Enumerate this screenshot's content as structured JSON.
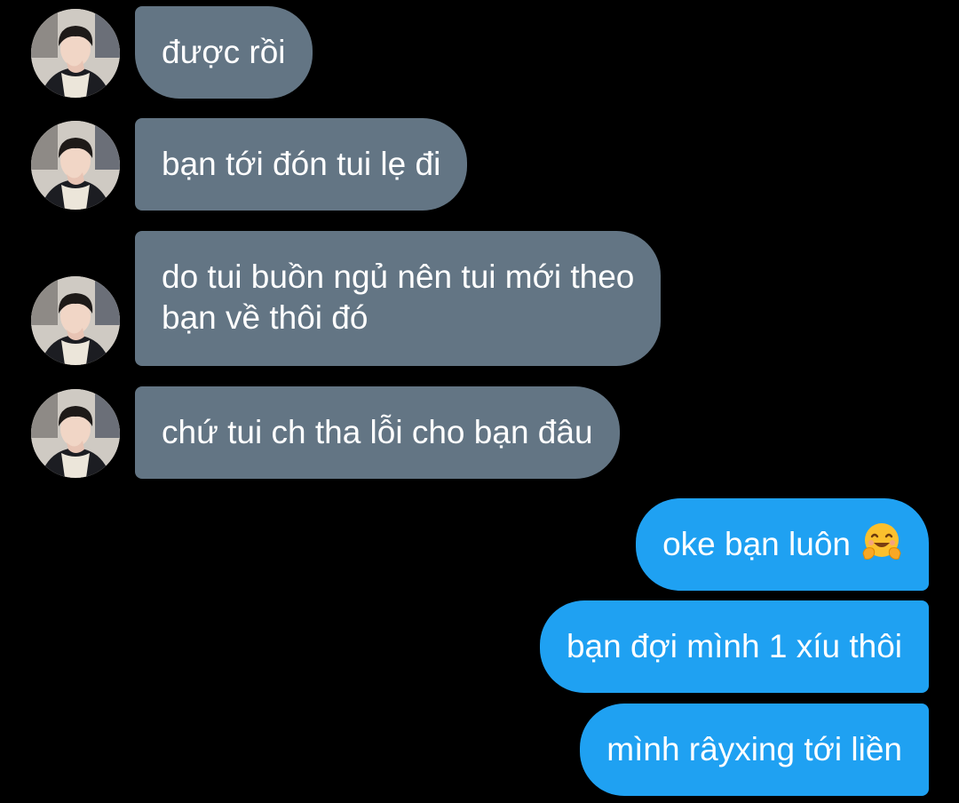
{
  "conversation": {
    "incoming": [
      {
        "text": "được rồi"
      },
      {
        "text": "bạn tới đón tui lẹ đi"
      },
      {
        "line1": "do tui buồn ngủ nên tui mới theo",
        "line2": "bạn về thôi đó"
      },
      {
        "text": "chứ tui ch tha lỗi cho bạn đâu"
      }
    ],
    "outgoing": [
      {
        "text": "oke bạn luôn",
        "emoji": "hugging-face-emoji"
      },
      {
        "text": "bạn đợi mình 1 xíu thôi"
      },
      {
        "text": "mình râyxing tới liền"
      }
    ]
  },
  "colors": {
    "background": "#000000",
    "incoming_bubble": "#637584",
    "outgoing_bubble": "#1fa1f2",
    "text": "#ffffff"
  }
}
